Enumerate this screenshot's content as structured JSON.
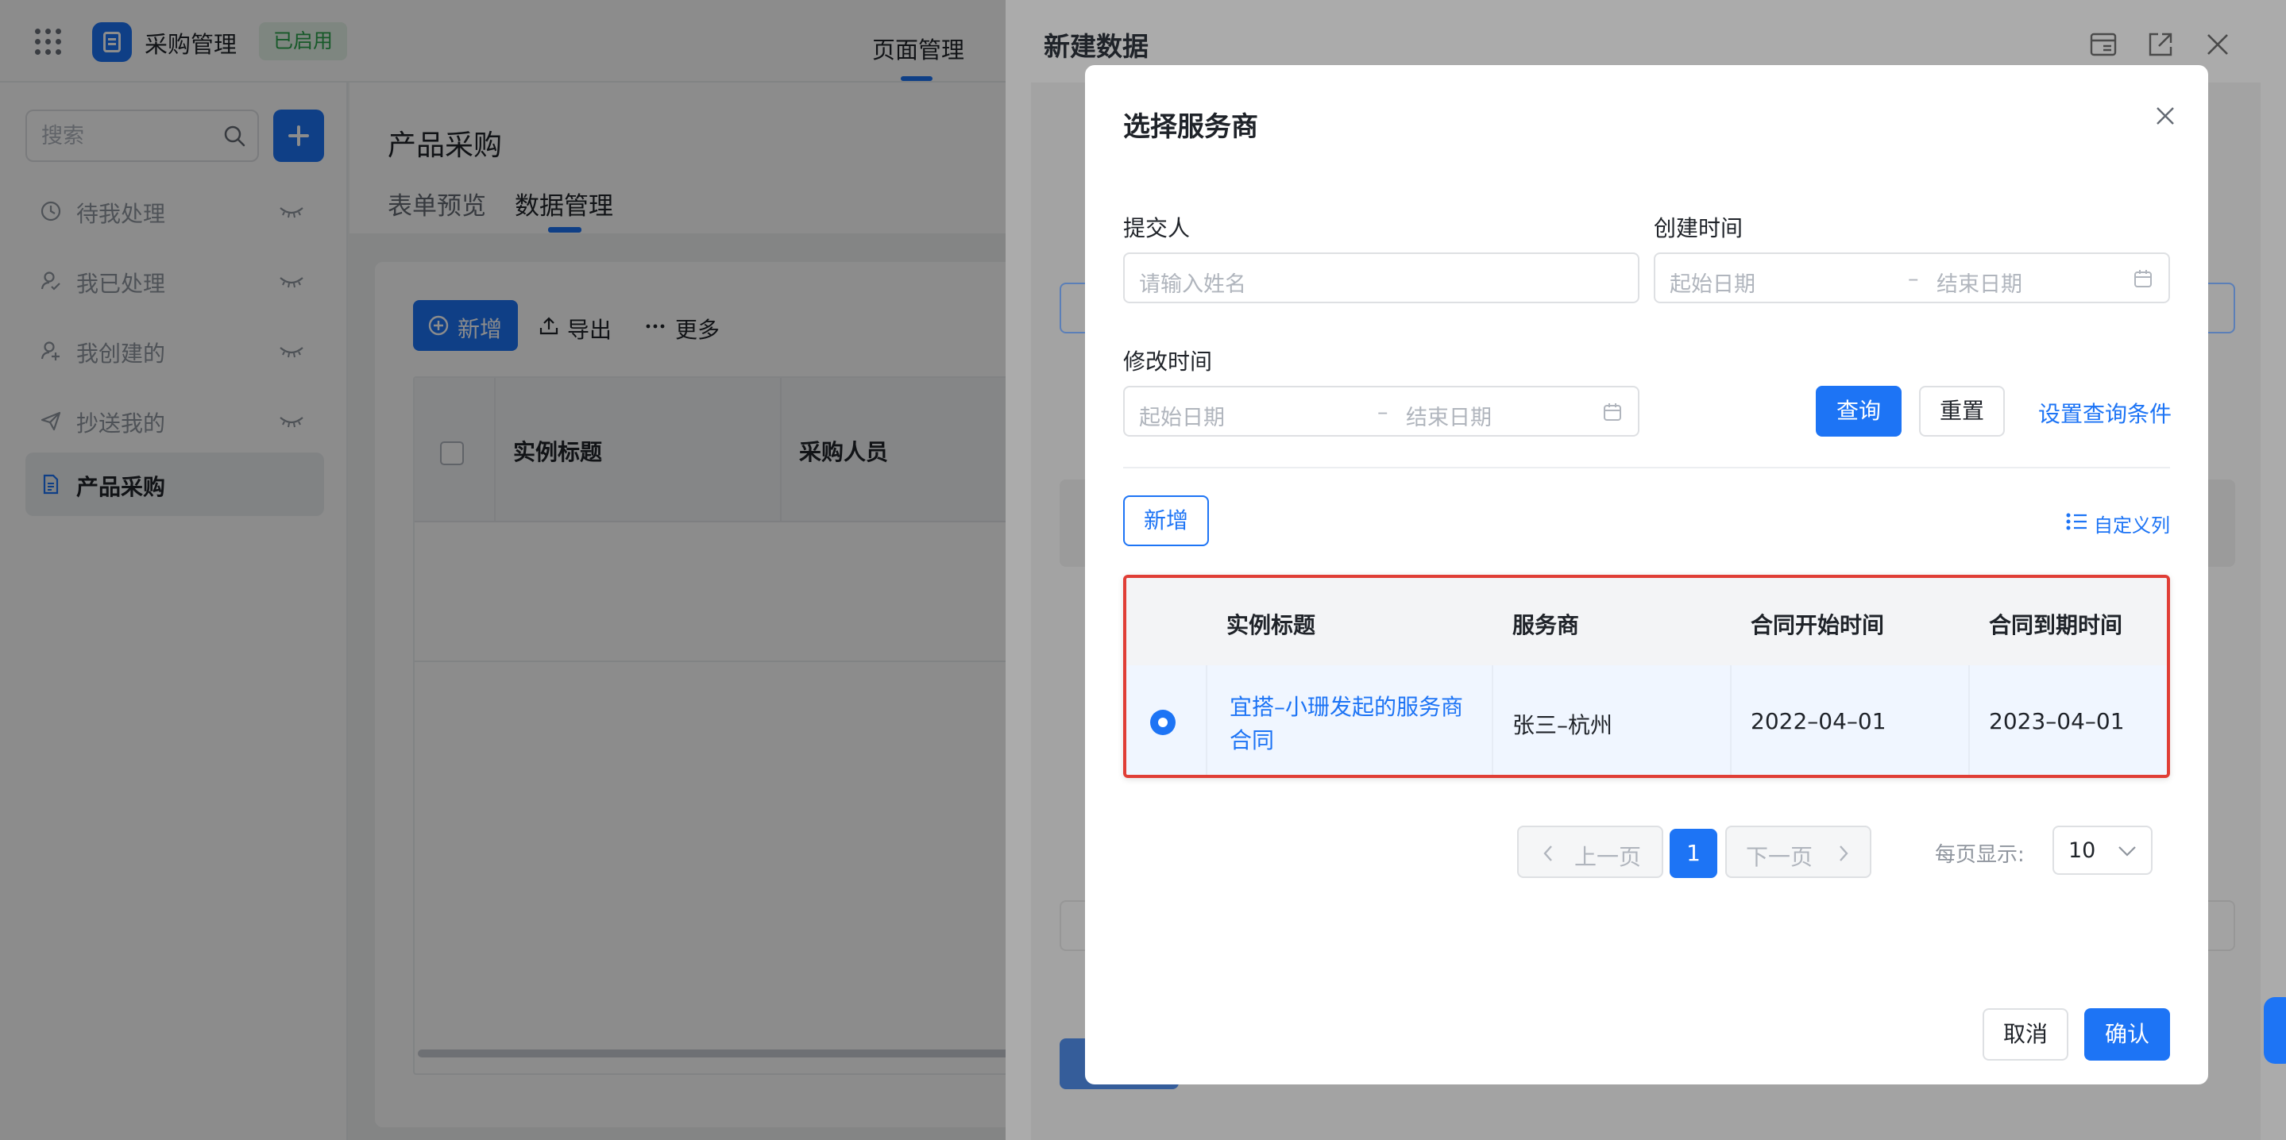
{
  "topbar": {
    "app_name": "采购管理",
    "status_badge": "已启用",
    "page_management": "页面管理"
  },
  "sidebar": {
    "search_placeholder": "搜索",
    "items": [
      {
        "label": "待我处理",
        "icon": "clock-icon"
      },
      {
        "label": "我已处理",
        "icon": "user-check-icon"
      },
      {
        "label": "我创建的",
        "icon": "user-add-icon"
      },
      {
        "label": "抄送我的",
        "icon": "send-icon"
      },
      {
        "label": "产品采购",
        "icon": "document-icon",
        "active": true
      }
    ]
  },
  "main": {
    "title": "产品采购",
    "tabs": [
      {
        "label": "表单预览",
        "active": false
      },
      {
        "label": "数据管理",
        "active": true
      }
    ],
    "toolbar": {
      "new": "新增",
      "export": "导出",
      "more": "更多"
    },
    "table": {
      "columns": [
        "实例标题",
        "采购人员"
      ]
    }
  },
  "drawer": {
    "title": "新建数据"
  },
  "modal": {
    "title": "选择服务商",
    "filters": {
      "submitter_label": "提交人",
      "submitter_placeholder": "请输入姓名",
      "created_label": "创建时间",
      "modified_label": "修改时间",
      "start_placeholder": "起始日期",
      "end_placeholder": "结束日期",
      "range_dash": "–"
    },
    "query_button": "查询",
    "reset_button": "重置",
    "set_conditions_link": "设置查询条件",
    "new_button": "新增",
    "custom_columns": "自定义列",
    "table": {
      "columns": [
        "实例标题",
        "服务商",
        "合同开始时间",
        "合同到期时间"
      ],
      "rows": [
        {
          "selected": true,
          "title": "宜搭–小珊发起的服务商合同",
          "provider": "张三–杭州",
          "start": "2022–04–01",
          "end": "2023–04–01"
        }
      ]
    },
    "pagination": {
      "prev": "上一页",
      "next": "下一页",
      "current_page": "1",
      "page_size_label": "每页显示:",
      "page_size": "10"
    },
    "cancel_button": "取消",
    "confirm_button": "确认"
  },
  "colors": {
    "primary": "#1d74f5",
    "highlight_border": "#e03e36",
    "status_green": "#2ba24c"
  }
}
